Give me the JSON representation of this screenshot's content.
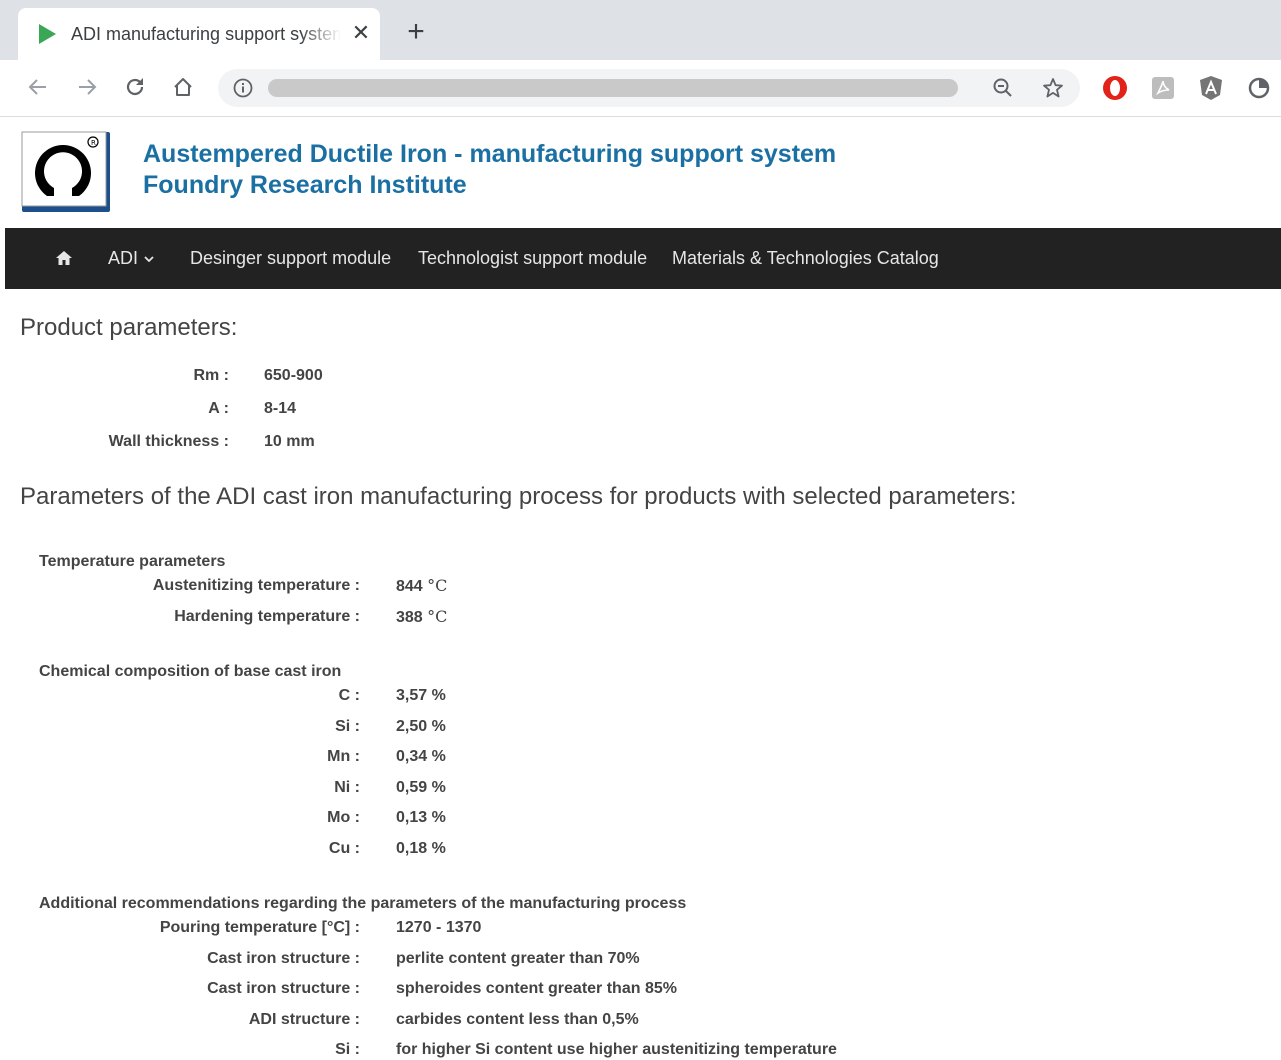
{
  "browser": {
    "tab_title": "ADI manufacturing support system",
    "close_glyph": "✕",
    "new_tab_glyph": "+",
    "icons": [
      "back-icon",
      "forward-icon",
      "reload-icon",
      "home-icon",
      "info-icon",
      "zoom-out-icon",
      "bookmark-star-icon",
      "opera-extension-icon",
      "pdf-extension-icon",
      "angular-extension-icon",
      "circle-extension-icon"
    ]
  },
  "site": {
    "title": "Austempered Ductile Iron - manufacturing support system",
    "subtitle": "Foundry Research Institute",
    "brand_color": "#1a6fa3"
  },
  "nav": {
    "adi": "ADI",
    "designer": "Desinger support module",
    "technologist": "Technologist support module",
    "catalog": "Materials & Technologies Catalog"
  },
  "product": {
    "heading": "Product parameters:",
    "rows": [
      {
        "label": "Rm :",
        "value": "650-900"
      },
      {
        "label": "A :",
        "value": "8-14"
      },
      {
        "label": "Wall thickness :",
        "value": "10 mm"
      }
    ]
  },
  "process": {
    "heading": "Parameters of the ADI cast iron manufacturing process for products with selected parameters:",
    "temperature": {
      "title": "Temperature parameters",
      "rows": [
        {
          "label": "Austenitizing temperature :",
          "value": "844",
          "unit": "°C"
        },
        {
          "label": "Hardening temperature :",
          "value": "388",
          "unit": "°C"
        }
      ]
    },
    "chemical": {
      "title": "Chemical composition of base cast iron",
      "rows": [
        {
          "label": "C :",
          "value": "3,57 %"
        },
        {
          "label": "Si :",
          "value": "2,50 %"
        },
        {
          "label": "Mn :",
          "value": "0,34 %"
        },
        {
          "label": "Ni :",
          "value": "0,59 %"
        },
        {
          "label": "Mo :",
          "value": "0,13 %"
        },
        {
          "label": "Cu :",
          "value": "0,18 %"
        }
      ]
    },
    "additional": {
      "title": "Additional recommendations regarding the parameters of the manufacturing process",
      "rows": [
        {
          "label": "Pouring temperature [°C] :",
          "value": "1270 - 1370"
        },
        {
          "label": "Cast iron structure :",
          "value": "perlite content greater than 70%"
        },
        {
          "label": "Cast iron structure :",
          "value": "spheroides content greater than 85%"
        },
        {
          "label": "ADI structure :",
          "value": "carbides content less than 0,5%"
        },
        {
          "label": "Si :",
          "value": "for higher Si content use higher austenitizing temperature"
        }
      ]
    }
  }
}
